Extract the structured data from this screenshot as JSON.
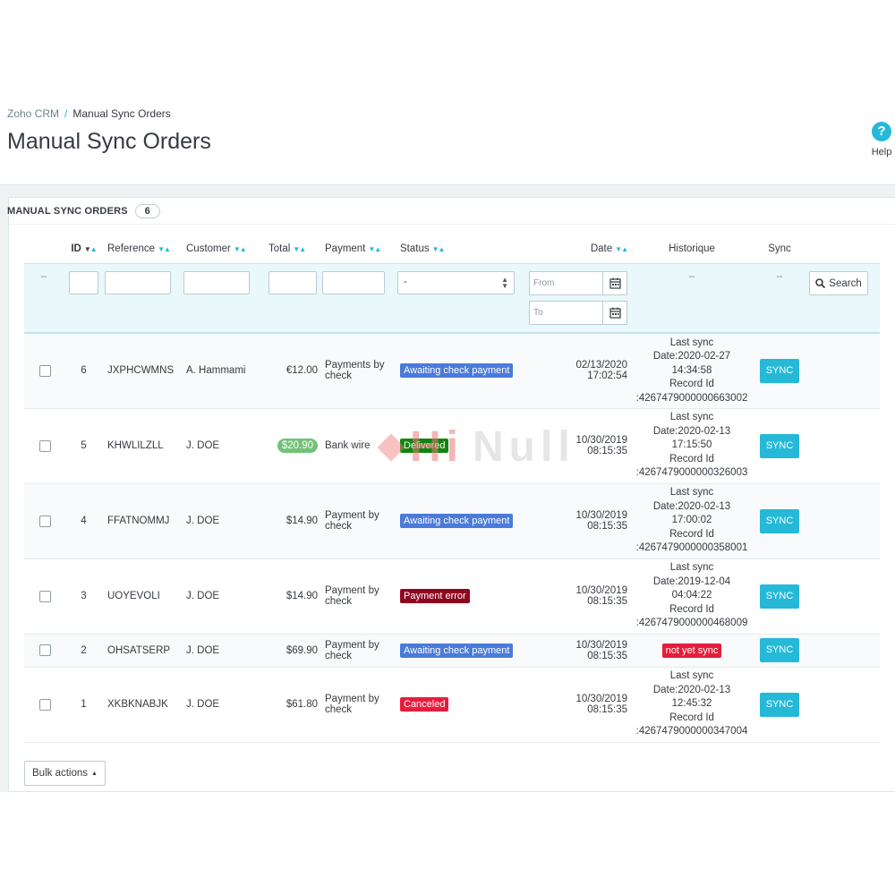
{
  "breadcrumb": {
    "parent": "Zoho CRM",
    "separator": "/",
    "current": "Manual Sync Orders"
  },
  "page_title": "Manual Sync Orders",
  "help": {
    "label": "Help",
    "icon": "help-icon"
  },
  "panel": {
    "heading": "MANUAL SYNC ORDERS",
    "count": "6"
  },
  "columns": {
    "id": "ID",
    "reference": "Reference",
    "customer": "Customer",
    "total": "Total",
    "payment": "Payment",
    "status": "Status",
    "date": "Date",
    "historique": "Historique",
    "sync": "Sync"
  },
  "filters": {
    "bulk_dash": "--",
    "status_selected": "-",
    "date_from_placeholder": "From",
    "date_to_placeholder": "To",
    "historique_dash": "--",
    "sync_dash": "--",
    "search_label": "Search"
  },
  "rows": [
    {
      "id": "6",
      "reference": "JXPHCWMNS",
      "customer": "A. Hammami",
      "total": "€12.00",
      "payment_1": "Payments by",
      "payment_2": "check",
      "status": "Awaiting check payment",
      "status_color": "#4a7bd9",
      "date": "02/13/2020",
      "time": "17:02:54",
      "hist_1": "Last sync",
      "hist_2": "Date:2020-02-27",
      "hist_3": "14:34:58",
      "hist_4": "Record Id",
      "hist_5": ":4267479000000663002",
      "sync": "SYNC"
    },
    {
      "id": "5",
      "reference": "KHWLILZLL",
      "customer": "J. DOE",
      "total": "$20.90",
      "payment_1": "Bank wire",
      "payment_2": "",
      "status": "Delivered",
      "status_color": "#108510",
      "date": "10/30/2019",
      "time": "08:15:35",
      "hist_1": "Last sync",
      "hist_2": "Date:2020-02-13",
      "hist_3": "17:15:50",
      "hist_4": "Record Id",
      "hist_5": ":4267479000000326003",
      "sync": "SYNC"
    },
    {
      "id": "4",
      "reference": "FFATNOMMJ",
      "customer": "J. DOE",
      "total": "$14.90",
      "payment_1": "Payment by",
      "payment_2": "check",
      "status": "Awaiting check payment",
      "status_color": "#4a7bd9",
      "date": "10/30/2019",
      "time": "08:15:35",
      "hist_1": "Last sync",
      "hist_2": "Date:2020-02-13",
      "hist_3": "17:00:02",
      "hist_4": "Record Id",
      "hist_5": ":4267479000000358001",
      "sync": "SYNC"
    },
    {
      "id": "3",
      "reference": "UOYEVOLI",
      "customer": "J. DOE",
      "total": "$14.90",
      "payment_1": "Payment by",
      "payment_2": "check",
      "status": "Payment error",
      "status_color": "#8f0621",
      "date": "10/30/2019",
      "time": "08:15:35",
      "hist_1": "Last sync",
      "hist_2": "Date:2019-12-04",
      "hist_3": "04:04:22",
      "hist_4": "Record Id",
      "hist_5": ":4267479000000468009",
      "sync": "SYNC"
    },
    {
      "id": "2",
      "reference": "OHSATSERP",
      "customer": "J. DOE",
      "total": "$69.90",
      "payment_1": "Payment by",
      "payment_2": "check",
      "status": "Awaiting check payment",
      "status_color": "#4a7bd9",
      "date": "10/30/2019",
      "time": "08:15:35",
      "not_synced": "not yet sync",
      "sync": "SYNC"
    },
    {
      "id": "1",
      "reference": "XKBKNABJK",
      "customer": "J. DOE",
      "total": "$61.80",
      "payment_1": "Payment by",
      "payment_2": "check",
      "status": "Canceled",
      "status_color": "#e51d3d",
      "date": "10/30/2019",
      "time": "08:15:35",
      "hist_1": "Last sync",
      "hist_2": "Date:2020-02-13",
      "hist_3": "12:45:32",
      "hist_4": "Record Id",
      "hist_5": ":4267479000000347004",
      "sync": "SYNC"
    }
  ],
  "bulk_actions": "Bulk actions",
  "watermark": {
    "left": "Hi",
    "right": "Null"
  },
  "colors": {
    "accent": "#25b9d7",
    "filter_bg": "#eaf7fb",
    "title": "#363a41"
  }
}
